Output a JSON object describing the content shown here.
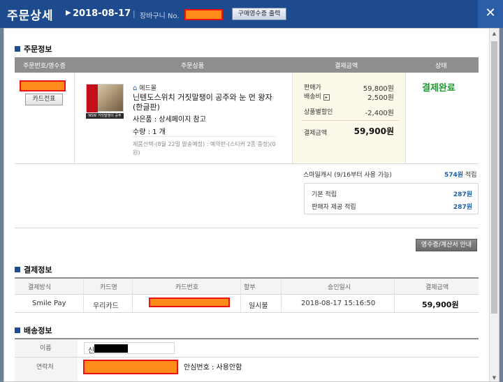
{
  "header": {
    "title": "주문상세",
    "date": "2018-08-17",
    "cart_no_label": "장바구니 No.",
    "receipt_button": "구매영수증 출력",
    "close_icon": "close-icon"
  },
  "order_info": {
    "section_title": "주문정보",
    "columns": [
      "주문번호/영수증",
      "주문상품",
      "결제금액",
      "상태"
    ],
    "card_slip_button": "카드전표",
    "seller": "에드몰",
    "product_name": "닌텐도스위치 거짓말쟁이 공주와 눈 먼 왕자 (한글판)",
    "gift": "사은품 : 상세페이지 참고",
    "quantity": "수량 : 1 개",
    "option": "제품선택-(8월 22일 발송예정) : 예약판-(스티커 2종 증정)(0원)",
    "thumb_caption": "NSW 거짓말쟁이 공주",
    "payment": {
      "sale_price_label": "판매가",
      "sale_price": "59,800원",
      "shipping_label": "배송비",
      "shipping": "2,500원",
      "discount_label": "상품별할인",
      "discount": "-2,400원",
      "total_label": "결제금액",
      "total": "59,900원"
    },
    "status": "결제완료",
    "smile_cash": {
      "label": "스마일캐시 (9/16부터 사용 가능)",
      "amount": "574원",
      "accrual_label": "적립",
      "basic_label": "기본 적립",
      "basic": "287원",
      "seller_label": "판매자 제공 적립",
      "seller": "287원"
    },
    "receipt_guide_button": "영수증/계산서 안내"
  },
  "payment_info": {
    "section_title": "결제정보",
    "columns": [
      "결제방식",
      "카드명",
      "카드번호",
      "할부",
      "승인일시",
      "결제금액"
    ],
    "row": {
      "method": "Smile Pay",
      "card_name": "우리카드",
      "installment": "일시불",
      "approved_at": "2018-08-17 15:16:50",
      "amount": "59,900원"
    }
  },
  "shipping_info": {
    "section_title": "배송정보",
    "name_label": "이름",
    "name_value": "신",
    "contact_label": "연락처",
    "safe_number": "안심번호 : 사용안함"
  },
  "colors": {
    "header": "#1d4b8e",
    "status_green": "#1b9a2c",
    "accent_blue": "#1c5fa6",
    "redaction": "#ff8c1a"
  }
}
